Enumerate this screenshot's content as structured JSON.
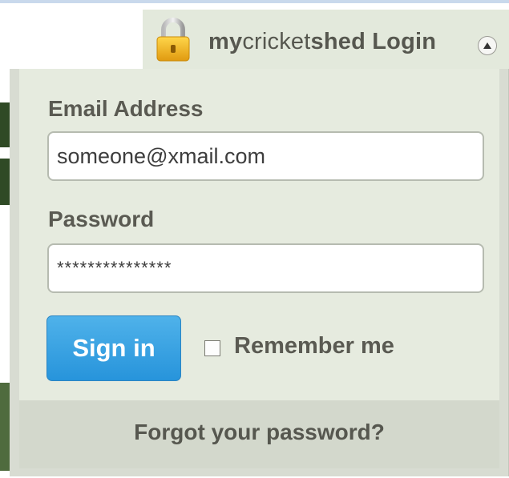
{
  "header": {
    "brand_my": "my",
    "brand_cricket": "cricket",
    "brand_shed": "shed",
    "brand_login": " Login",
    "lock_icon": "padlock-icon",
    "toggle_icon": "chevron-up-icon"
  },
  "form": {
    "email_label": "Email Address",
    "email_value": "someone@xmail.com",
    "password_label": "Password",
    "password_value": "***************",
    "signin_label": "Sign in",
    "remember_label": "Remember me",
    "remember_checked": false,
    "forgot_label": "Forgot your password?"
  },
  "colors": {
    "button": "#2794db",
    "panel": "#e6ebdf",
    "text": "#5a5a52"
  }
}
